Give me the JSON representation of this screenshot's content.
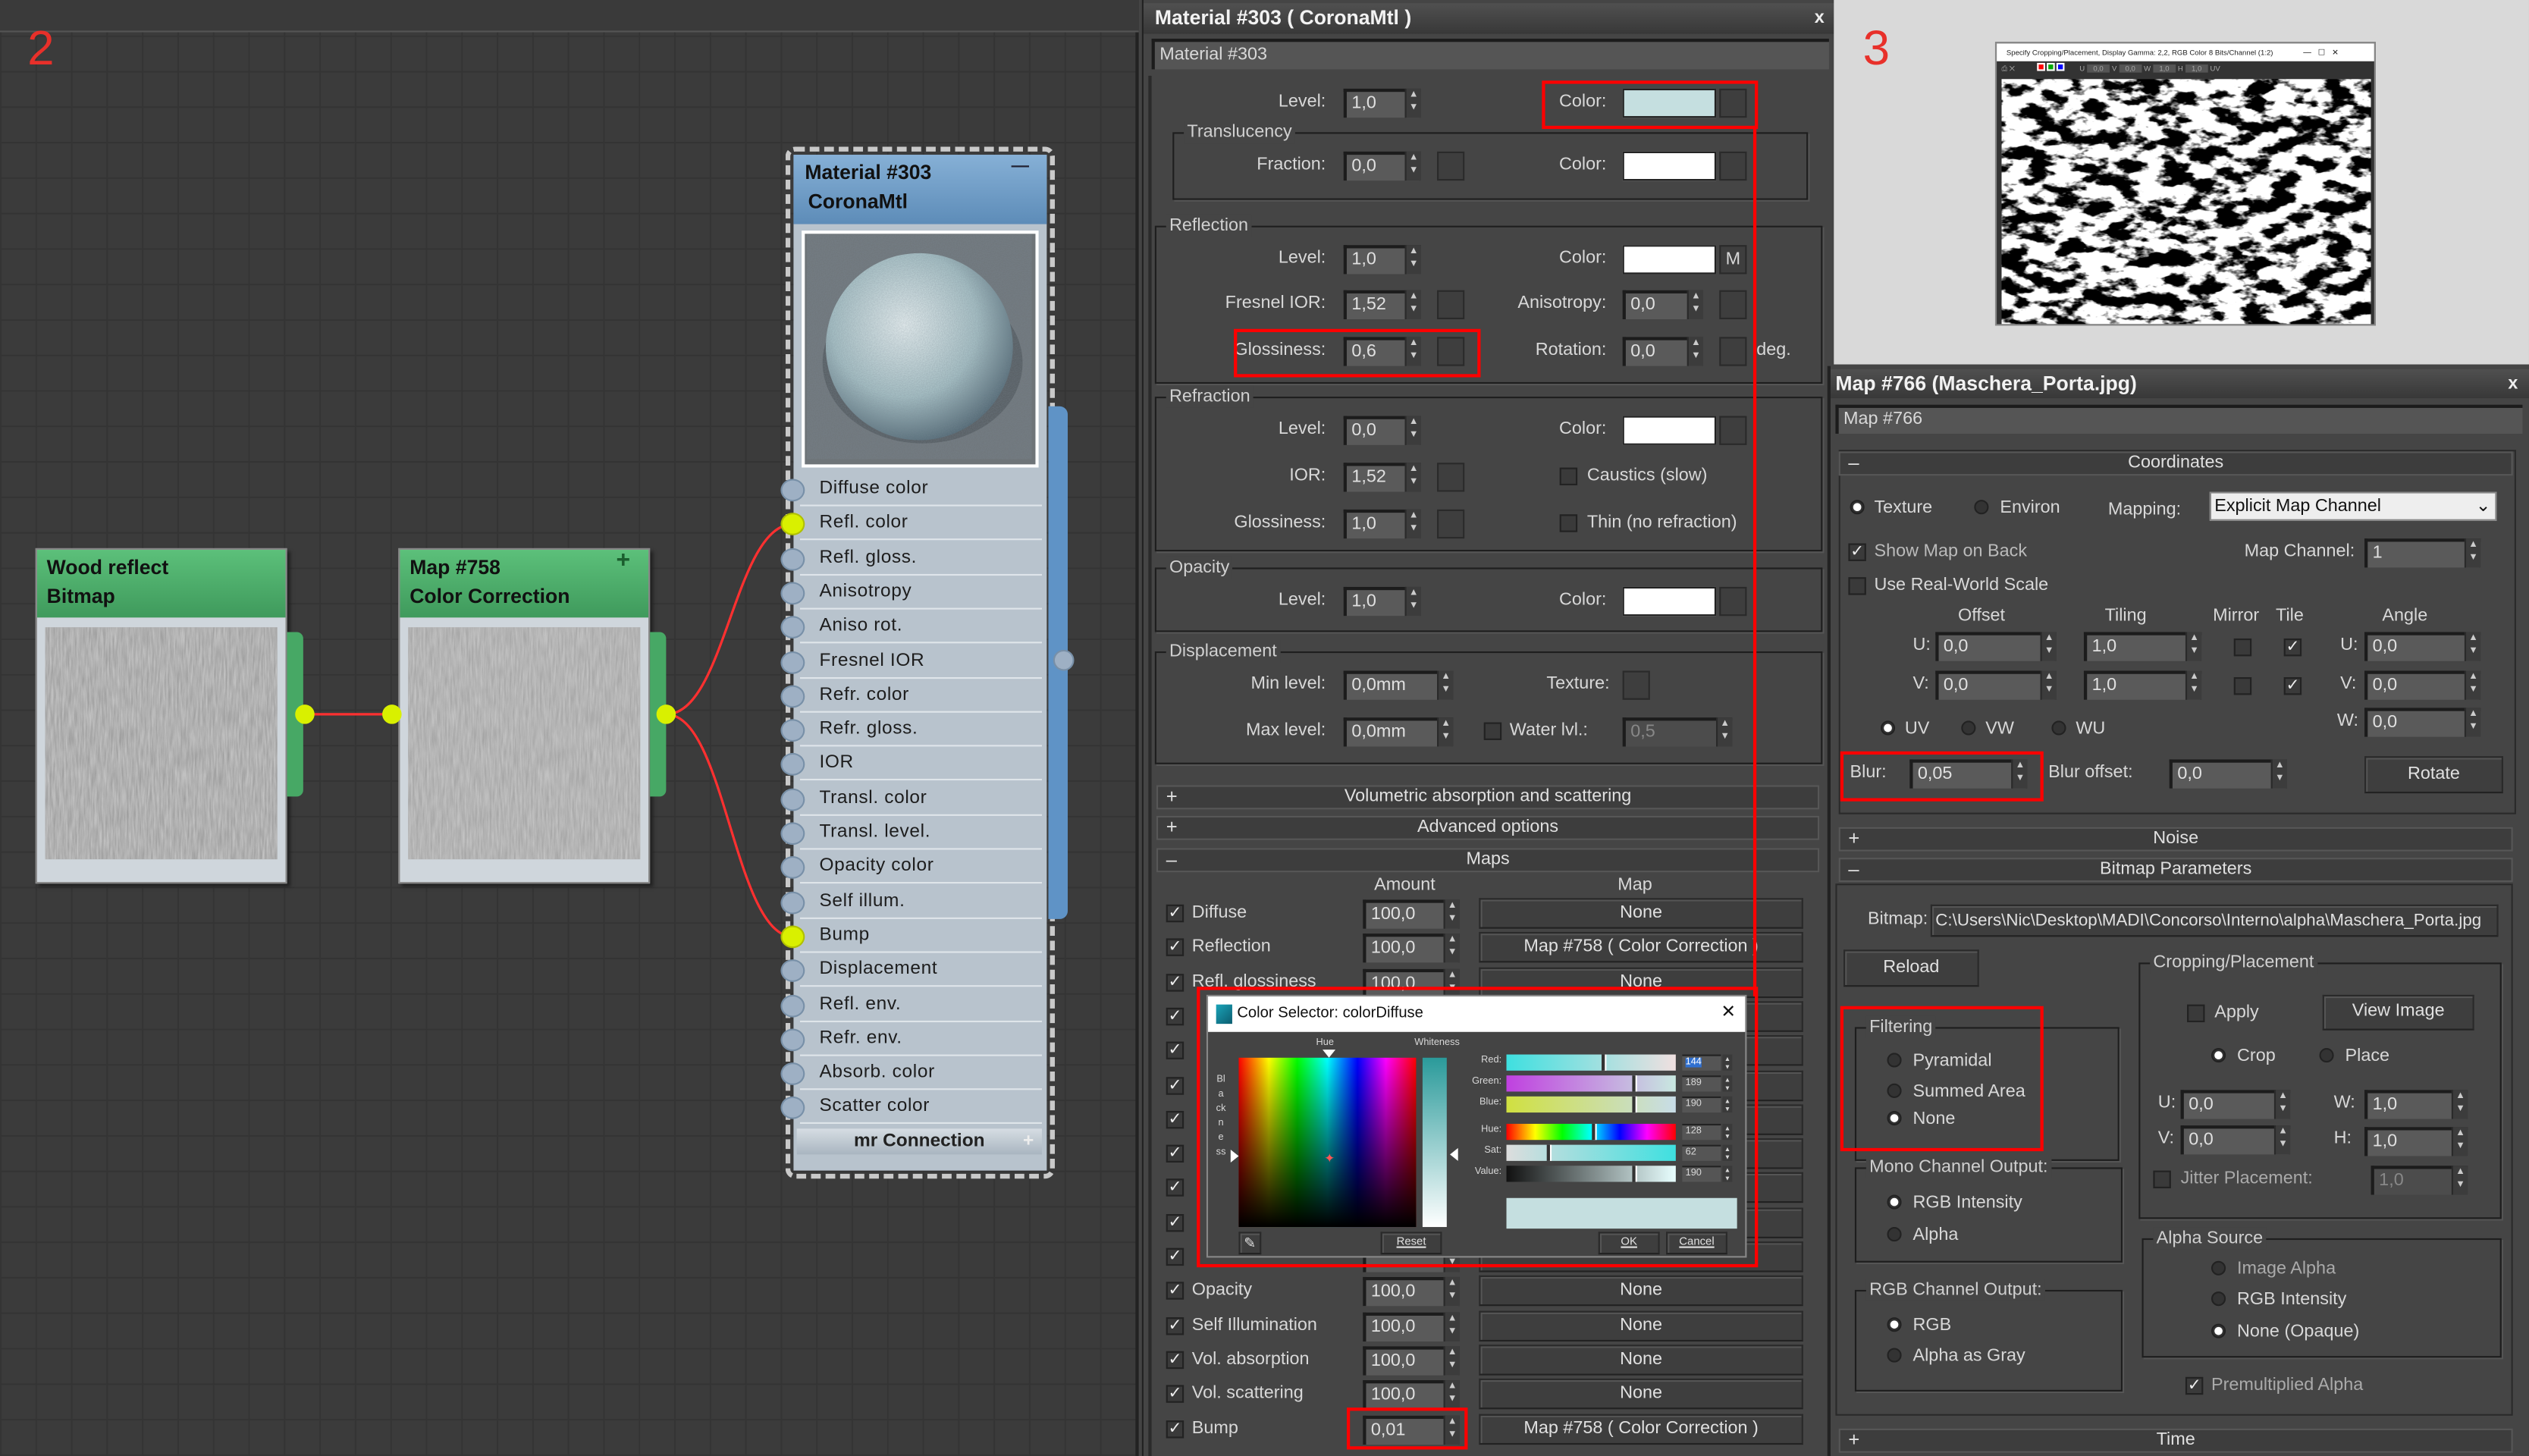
{
  "annotations": {
    "label_2": "2",
    "label_3": "3",
    "highlight_color": "#ff0000"
  },
  "node_editor": {
    "nodes": [
      {
        "title_1": "Wood reflect",
        "title_2": "Bitmap",
        "header_color": "#47a865"
      },
      {
        "title_1": "Map #758",
        "title_2": "Color Correction",
        "header_color": "#47a865",
        "icon": "plus-icon"
      }
    ],
    "material_node": {
      "title_1": "Material #303",
      "title_2": "CoronaMtl",
      "header_color": "#6b9ac4",
      "collapse": "—",
      "slots": [
        {
          "label": "Diffuse color",
          "connected": false
        },
        {
          "label": "Refl. color",
          "connected": true
        },
        {
          "label": "Refl. gloss.",
          "connected": false
        },
        {
          "label": "Anisotropy",
          "connected": false
        },
        {
          "label": "Aniso rot.",
          "connected": false
        },
        {
          "label": "Fresnel IOR",
          "connected": false
        },
        {
          "label": "Refr. color",
          "connected": false
        },
        {
          "label": "Refr. gloss.",
          "connected": false
        },
        {
          "label": "IOR",
          "connected": false
        },
        {
          "label": "Transl. color",
          "connected": false
        },
        {
          "label": "Transl. level.",
          "connected": false
        },
        {
          "label": "Opacity color",
          "connected": false
        },
        {
          "label": "Self illum.",
          "connected": false
        },
        {
          "label": "Bump",
          "connected": true
        },
        {
          "label": "Displacement",
          "connected": false
        },
        {
          "label": "Refl. env.",
          "connected": false
        },
        {
          "label": "Refr. env.",
          "connected": false
        },
        {
          "label": "Absorb. color",
          "connected": false
        },
        {
          "label": "Scatter color",
          "connected": false
        }
      ],
      "footer": "mr Connection",
      "footer_icon": "+"
    },
    "wire_color": "#ff3030"
  },
  "material_editor": {
    "title": "Material #303  ( CoronaMtl )",
    "close": "x",
    "name": "Material #303",
    "diffuse": {
      "level_label": "Level:",
      "level": "1,0",
      "color_label": "Color:",
      "color": "#c5dfe0"
    },
    "translucency": {
      "group": "Translucency",
      "fraction_label": "Fraction:",
      "fraction": "0,0",
      "color_label": "Color:",
      "color": "#ffffff"
    },
    "reflection": {
      "group": "Reflection",
      "level_label": "Level:",
      "level": "1,0",
      "color_label": "Color:",
      "color": "#ffffff",
      "map_flag": "M",
      "fresnel_label": "Fresnel IOR:",
      "fresnel": "1,52",
      "aniso_label": "Anisotropy:",
      "aniso": "0,0",
      "gloss_label": "Glossiness:",
      "gloss": "0,6",
      "rotation_label": "Rotation:",
      "rotation": "0,0",
      "deg": "deg."
    },
    "refraction": {
      "group": "Refraction",
      "level_label": "Level:",
      "level": "0,0",
      "color_label": "Color:",
      "color": "#ffffff",
      "ior_label": "IOR:",
      "ior": "1,52",
      "caustics": "Caustics (slow)",
      "gloss_label": "Glossiness:",
      "gloss": "1,0",
      "thin": "Thin (no refraction)"
    },
    "opacity": {
      "group": "Opacity",
      "level_label": "Level:",
      "level": "1,0",
      "color_label": "Color:",
      "color": "#ffffff"
    },
    "displacement": {
      "group": "Displacement",
      "min_label": "Min level:",
      "min": "0,0mm",
      "texture_label": "Texture:",
      "max_label": "Max level:",
      "max": "0,0mm",
      "water_label": "Water lvl.:",
      "water": "0,5"
    },
    "rollouts": {
      "volumetric": "Volumetric absorption and scattering",
      "advanced": "Advanced options",
      "maps": "Maps"
    },
    "maps": {
      "amount_header": "Amount",
      "map_header": "Map",
      "rows": [
        {
          "label": "Diffuse",
          "amount": "100,0",
          "map": "None"
        },
        {
          "label": "Reflection",
          "amount": "100,0",
          "map": "Map #758  ( Color Correction )"
        },
        {
          "label": "Refl. glossiness",
          "amount": "100,0",
          "map": "None"
        },
        {
          "label": "",
          "amount": "",
          "map": ""
        },
        {
          "label": "",
          "amount": "",
          "map": ""
        },
        {
          "label": "",
          "amount": "",
          "map": ""
        },
        {
          "label": "",
          "amount": "",
          "map": ""
        },
        {
          "label": "",
          "amount": "",
          "map": ""
        },
        {
          "label": "",
          "amount": "",
          "map": ""
        },
        {
          "label": "",
          "amount": "",
          "map": ""
        },
        {
          "label": "",
          "amount": "",
          "map": ""
        },
        {
          "label": "Opacity",
          "amount": "100,0",
          "map": "None"
        },
        {
          "label": "Self Illumination",
          "amount": "100,0",
          "map": "None"
        },
        {
          "label": "Vol. absorption",
          "amount": "100,0",
          "map": "None"
        },
        {
          "label": "Vol. scattering",
          "amount": "100,0",
          "map": "None"
        },
        {
          "label": "Bump",
          "amount": "0,01",
          "map": "Map #758  ( Color Correction )"
        }
      ]
    }
  },
  "color_selector": {
    "title": "Color Selector: colorDiffuse",
    "close": "✕",
    "hue_label": "Hue",
    "whiteness_label": "Whiteness",
    "blackness_label": "Blackness",
    "red_label": "Red:",
    "red": "144",
    "green_label": "Green:",
    "green": "189",
    "blue_label": "Blue:",
    "blue": "190",
    "hue2_label": "Hue:",
    "hue": "128",
    "sat_label": "Sat:",
    "sat": "62",
    "value_label": "Value:",
    "value": "190",
    "preview_color": "#c5dfe0",
    "reset": "Reset",
    "ok": "OK",
    "cancel": "Cancel"
  },
  "image_viewer": {
    "title": "Specify Cropping/Placement, Display Gamma: 2,2, RGB Color 8 Bits/Channel (1:2)",
    "u_label": "U",
    "u": "0,0",
    "v_label": "V",
    "v": "0,0",
    "w_label": "W",
    "w": "1,0",
    "h_label": "H",
    "h": "1,0",
    "uv": "UV"
  },
  "map_editor": {
    "title": "Map #766 (Maschera_Porta.jpg)",
    "close": "x",
    "name": "Map #766",
    "coordinates": {
      "rollout": "Coordinates",
      "texture": "Texture",
      "environ": "Environ",
      "mapping_label": "Mapping:",
      "mapping": "Explicit Map Channel",
      "show_map_on_back": "Show Map on Back",
      "map_channel_label": "Map Channel:",
      "map_channel": "1",
      "real_world": "Use Real-World Scale",
      "offset": "Offset",
      "tiling": "Tiling",
      "mirror": "Mirror",
      "tile": "Tile",
      "angle": "Angle",
      "u_label": "U:",
      "v_label": "V:",
      "w_label": "W:",
      "offset_u": "0,0",
      "offset_v": "0,0",
      "tiling_u": "1,0",
      "tiling_v": "1,0",
      "angle_u": "0,0",
      "angle_v": "0,0",
      "angle_w": "0,0",
      "uv": "UV",
      "vw": "VW",
      "wu": "WU",
      "blur_label": "Blur:",
      "blur": "0,05",
      "blur_offset_label": "Blur offset:",
      "blur_offset": "0,0",
      "rotate": "Rotate"
    },
    "noise_rollout": "Noise",
    "bitmap": {
      "rollout": "Bitmap Parameters",
      "bitmap_label": "Bitmap:",
      "path": "C:\\Users\\Nic\\Desktop\\MADI\\Concorso\\Interno\\alpha\\Maschera_Porta.jpg",
      "reload": "Reload",
      "filtering": "Filtering",
      "pyramidal": "Pyramidal",
      "summed": "Summed Area",
      "none": "None",
      "mono": "Mono Channel Output:",
      "rgb_intensity": "RGB Intensity",
      "alpha": "Alpha",
      "rgb_out": "RGB Channel Output:",
      "rgb": "RGB",
      "alpha_gray": "Alpha as Gray",
      "cropping": "Cropping/Placement",
      "apply": "Apply",
      "view_image": "View Image",
      "crop": "Crop",
      "place": "Place",
      "u_label": "U:",
      "u": "0,0",
      "v_label": "V:",
      "v": "0,0",
      "w_label": "W:",
      "w": "1,0",
      "h_label": "H:",
      "h": "1,0",
      "jitter": "Jitter Placement:",
      "jitter_value": "1,0",
      "alpha_source": "Alpha Source",
      "image_alpha": "Image Alpha",
      "as_rgb_intensity": "RGB Intensity",
      "none_opaque": "None (Opaque)",
      "premultiplied": "Premultiplied Alpha"
    },
    "time_rollout": "Time"
  }
}
